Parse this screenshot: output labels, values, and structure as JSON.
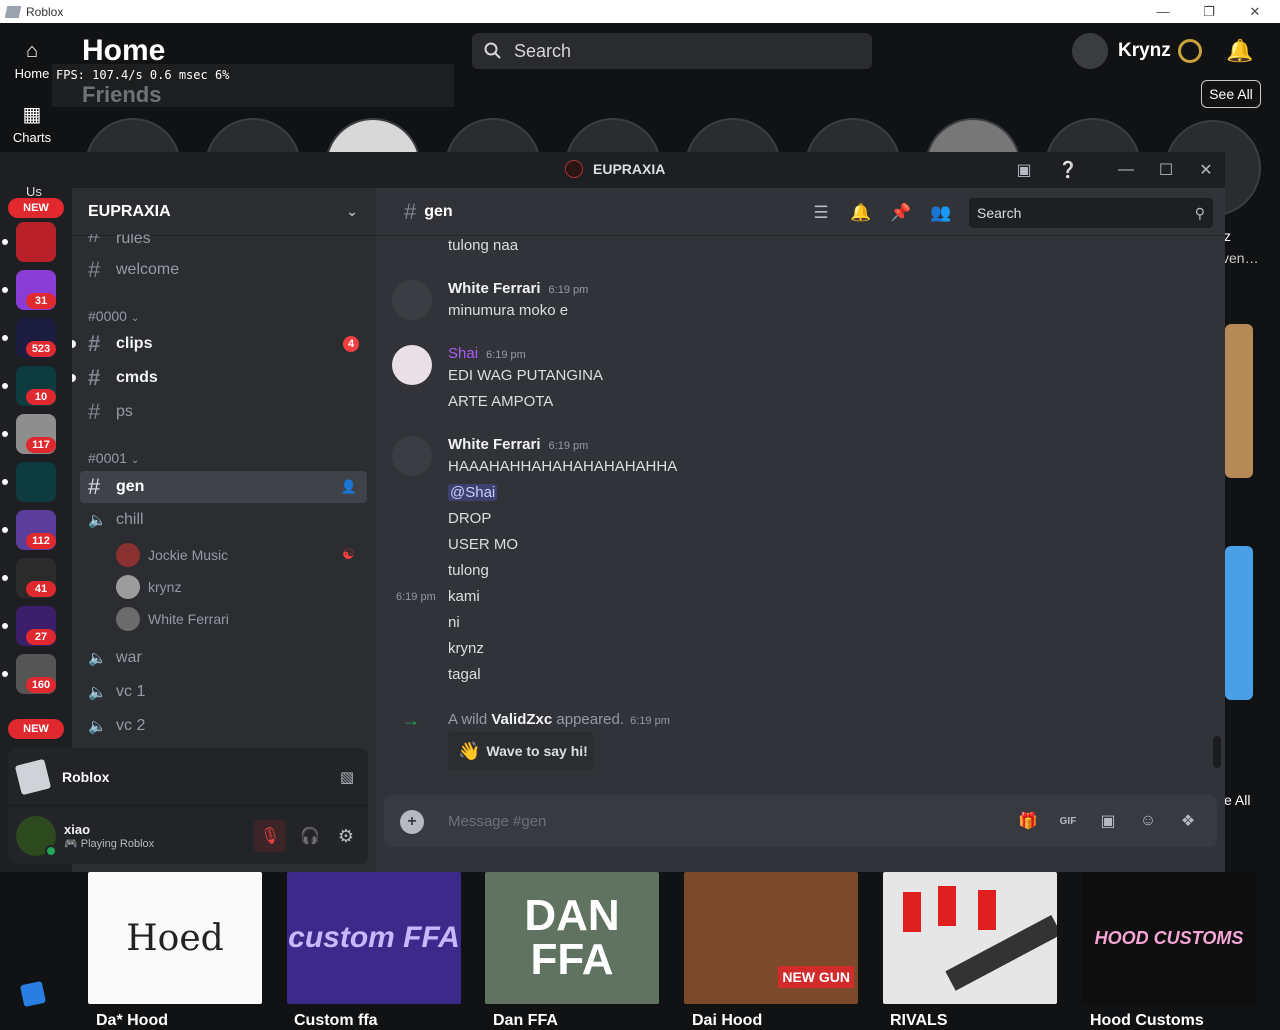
{
  "window": {
    "title": "Roblox"
  },
  "roblox": {
    "nav": {
      "home": "Home",
      "charts": "Charts"
    },
    "page_title": "Home",
    "fps_overlay": "FPS: 107.4/s 0.6 msec 6%",
    "section_friends": "Friends",
    "search_placeholder": "Search",
    "username": "Krynz",
    "see_all": "See All",
    "see_all_bottom": "e All",
    "right_partial_1": "z",
    "right_partial_2": "ven…",
    "sidebar_top_label": "Us",
    "new_label": "NEW",
    "badges": [
      "31",
      "523",
      "10",
      "117",
      "112",
      "41",
      "27",
      "160"
    ],
    "games": [
      {
        "name": "Da* Hood",
        "thumb_text": "Hoed"
      },
      {
        "name": "Custom ffa",
        "thumb_text": "custom FFA"
      },
      {
        "name": "Dan FFA",
        "thumb_text": "DAN FFA"
      },
      {
        "name": "Dai Hood",
        "thumb_text": "NEW GUN"
      },
      {
        "name": "RIVALS",
        "thumb_text": ""
      },
      {
        "name": "Hood Customs",
        "thumb_text": "HOOD CUSTOMS"
      }
    ],
    "colors": {
      "background": "#111214",
      "badge_red": "#e0282f",
      "robux_gold": "#c9a33a"
    }
  },
  "discord": {
    "window_title": "EUPRAXIA",
    "server_name": "EUPRAXIA",
    "channels_top": {
      "partial": "rules",
      "welcome": "welcome"
    },
    "category_0000": "#0000",
    "category_0001": "#0001",
    "channels": {
      "clips": "clips",
      "clips_mentions": "4",
      "cmds": "cmds",
      "ps": "ps",
      "gen": "gen",
      "chill": "chill",
      "war": "war",
      "vc1": "vc 1",
      "vc2": "vc 2"
    },
    "voice_users": [
      "Jockie Music",
      "krynz",
      "White Ferrari"
    ],
    "activity": {
      "game": "Roblox"
    },
    "user": {
      "name": "xiao",
      "status": "Playing Roblox"
    },
    "chat": {
      "channel": "gen",
      "search_placeholder": "Search",
      "input_placeholder": "Message #gen",
      "messages": {
        "m0_text": "tulong naa",
        "m1_author": "White Ferrari",
        "m1_time": "6:19 pm",
        "m1_text": "minumura moko e",
        "m2_author": "Shai",
        "m2_time": "6:19 pm",
        "m2_line1": "EDI WAG PUTANGINA",
        "m2_line2": "ARTE AMPOTA",
        "m3_author": "White Ferrari",
        "m3_time": "6:19 pm",
        "m3_line1": "HAAAHAHHAHAHAHAHAHAHHA",
        "m3_mention": "@Shai",
        "m3_lines": [
          "DROP",
          "USER MO",
          "tulong",
          "kami",
          "ni",
          "krynz",
          "tagal"
        ],
        "hover_time": "6:19 pm"
      },
      "join": {
        "prefix": "A wild",
        "name": "ValidZxc",
        "suffix": "appeared.",
        "time": "6:19 pm",
        "wave_button": "Wave to say hi!"
      }
    },
    "colors": {
      "chat_bg": "#313338",
      "channels_bg": "#2b2d31",
      "guilds_bg": "#1e1f22",
      "shai_color": "#a95ef5",
      "mention_red": "#f23f42",
      "join_arrow": "#23a559"
    }
  }
}
